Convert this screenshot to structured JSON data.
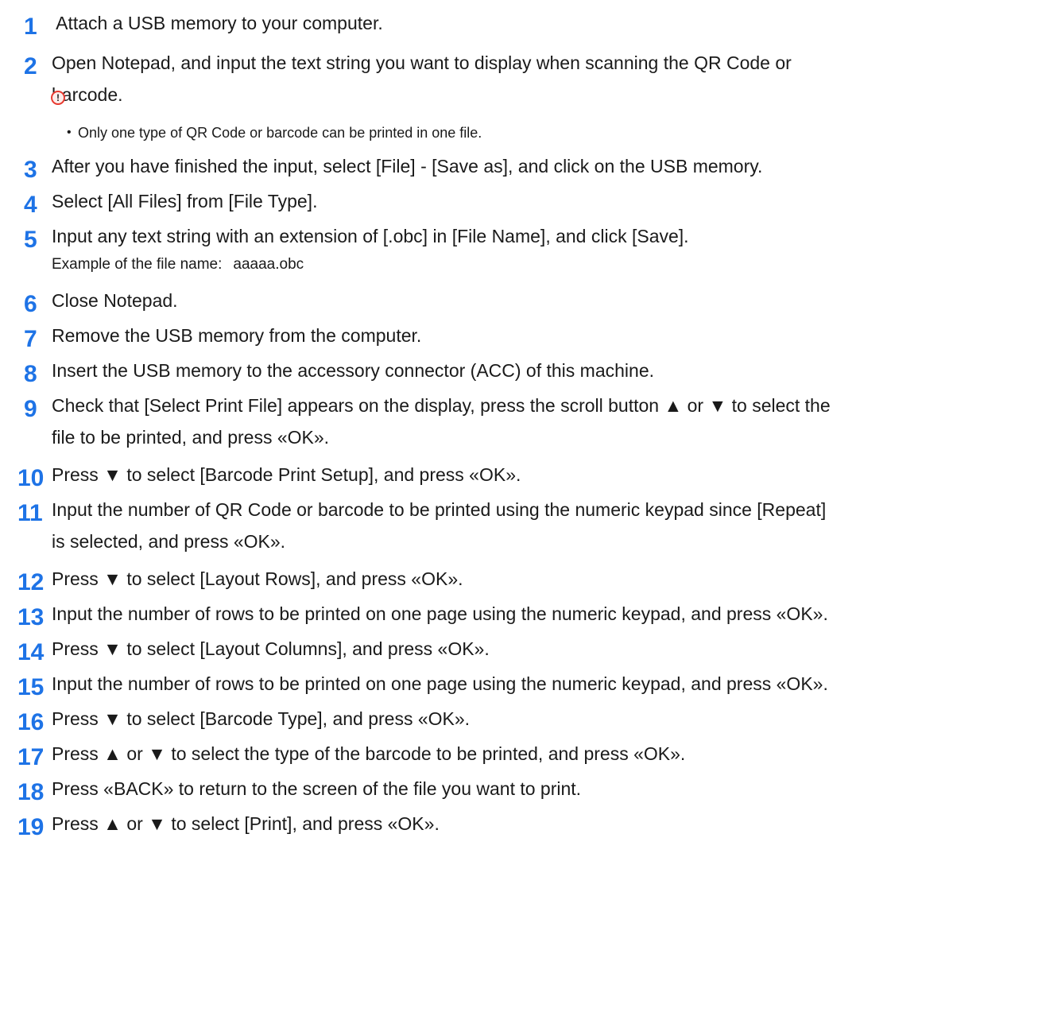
{
  "steps": [
    {
      "number": "1",
      "text": " Attach a USB memory to your computer."
    },
    {
      "number": "2",
      "text": "Open Notepad, and input the text string you want to display when scanning the QR Code or",
      "text_cont": "barcode."
    },
    {
      "number": "3",
      "text": "After you have finished the input, select [File] - [Save as], and click on the USB memory."
    },
    {
      "number": "4",
      "text": "Select [All Files] from [File Type]."
    },
    {
      "number": "5",
      "text": "Input any text string with an extension of [.obc] in [File Name], and click [Save].",
      "example_label": "Example of the file name:",
      "example_value": "aaaaa.obc"
    },
    {
      "number": "6",
      "text": "Close Notepad."
    },
    {
      "number": "7",
      "text": "Remove the USB memory from the computer."
    },
    {
      "number": "8",
      "text": "Insert the USB memory to the accessory connector (ACC) of this machine."
    },
    {
      "number": "9",
      "text": "Check that [Select Print File] appears on the display, press the scroll button ▲ or ▼ to select the",
      "text_cont": "file to be printed, and press «OK»."
    },
    {
      "number": "10",
      "text": "Press ▼ to select [Barcode Print Setup], and press «OK»."
    },
    {
      "number": "11",
      "text": "Input the number of QR Code or barcode to be printed using the numeric keypad since [Repeat]",
      "text_cont": "is selected, and press «OK»."
    },
    {
      "number": "12",
      "text": "Press ▼ to select [Layout Rows], and press «OK»."
    },
    {
      "number": "13",
      "text": "Input the number of rows to be printed on one page using the numeric keypad, and press «OK»."
    },
    {
      "number": "14",
      "text": "Press ▼ to select [Layout Columns], and press «OK»."
    },
    {
      "number": "15",
      "text": "Input the number of rows to be printed on one page using the numeric keypad, and press «OK»."
    },
    {
      "number": "16",
      "text": "Press ▼ to select [Barcode Type], and press «OK»."
    },
    {
      "number": "17",
      "text": "Press ▲ or ▼ to select the type of the barcode to be printed, and press «OK»."
    },
    {
      "number": "18",
      "text": "Press «BACK» to return to the screen of the file you want to print."
    },
    {
      "number": "19",
      "text": "Press ▲ or ▼ to select [Print], and press «OK»."
    }
  ],
  "note": {
    "icon": "warning-icon",
    "icon_glyph": "!",
    "text": "Only one type of QR Code or barcode can be printed in one file."
  },
  "colors": {
    "step_number": "#1e73e6",
    "warning": "#e8392f"
  }
}
